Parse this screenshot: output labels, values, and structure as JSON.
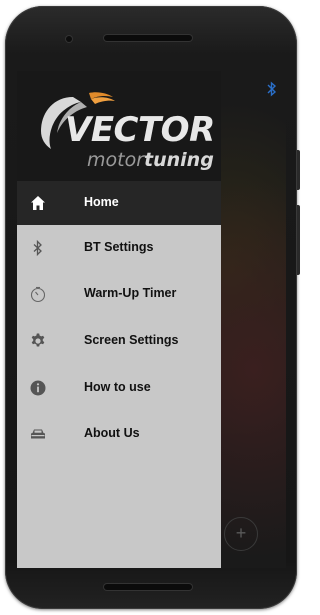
{
  "colors": {
    "drawer_bg": "#c8c8c8",
    "drawer_header_bg": "#181818",
    "active_item_bg": "#262626",
    "active_item_text": "#ffffff",
    "item_text": "#111111",
    "accent_blue": "#2a6fc9"
  },
  "drawer": {
    "logo": {
      "main": "VECTOR",
      "sub_light": "motor",
      "sub_bold": "tuning"
    },
    "items": [
      {
        "label": "Home",
        "icon": "home-icon",
        "active": true
      },
      {
        "label": "BT Settings",
        "icon": "bluetooth-icon",
        "active": false
      },
      {
        "label": "Warm-Up Timer",
        "icon": "timer-icon",
        "active": false
      },
      {
        "label": "Screen Settings",
        "icon": "settings-gear-icon",
        "active": false
      },
      {
        "label": "How to use",
        "icon": "info-icon",
        "active": false
      },
      {
        "label": "About Us",
        "icon": "car-icon",
        "active": false
      }
    ]
  },
  "app": {
    "status_icon": "bluetooth-icon",
    "fab_label": "+"
  }
}
